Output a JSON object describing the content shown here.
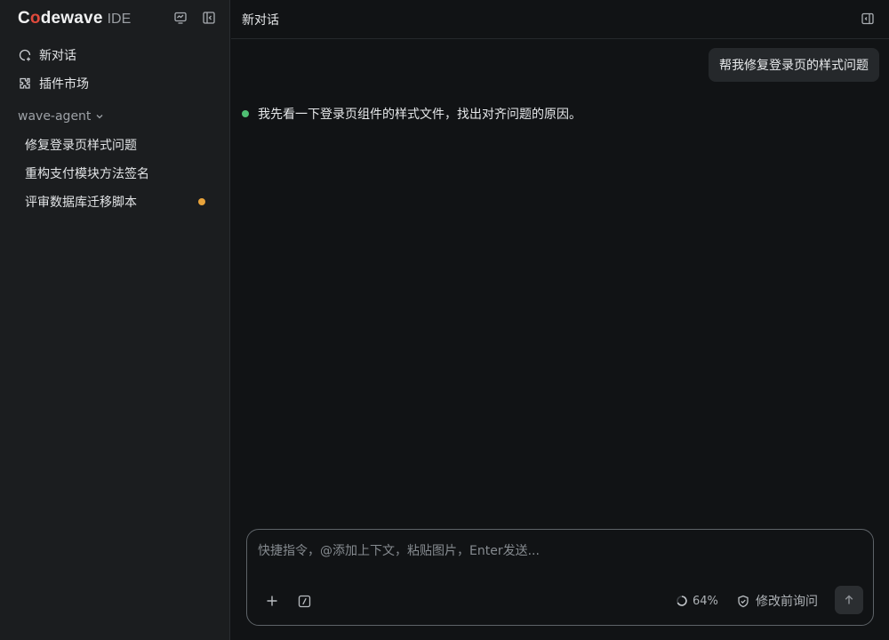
{
  "app": {
    "brand_c": "C",
    "brand_o": "o",
    "brand_rest": "dewave",
    "brand_suffix": "IDE"
  },
  "icons": {
    "monitor": "monitor-icon",
    "sidebar_toggle": "sidebar-collapse-icon",
    "new_chat": "new-chat-icon",
    "plugins": "puzzle-icon",
    "chevron": "chevron-down-icon",
    "panel": "panel-toggle-icon",
    "add": "plus-icon",
    "slash": "slash-command-icon",
    "progress": "spinner-icon",
    "shield": "shield-check-icon",
    "send": "arrow-up-icon"
  },
  "sidebar": {
    "nav": [
      {
        "label": "新对话"
      },
      {
        "label": "插件市场"
      }
    ],
    "group": {
      "label": "wave-agent"
    },
    "sessions": [
      {
        "label": "修复登录页样式问题",
        "unread": false
      },
      {
        "label": "重构支付模块方法签名",
        "unread": false
      },
      {
        "label": "评审数据库迁移脚本",
        "unread": true
      }
    ]
  },
  "main": {
    "title": "新对话",
    "user_message": "帮我修复登录页的样式问题",
    "assistant_message": "我先看一下登录页组件的样式文件，找出对齐问题的原因。"
  },
  "composer": {
    "placeholder": "快捷指令，@添加上下文，粘贴图片，Enter发送...",
    "value": "",
    "context_usage": "64%",
    "context_fraction": 0.64,
    "mode_label": "修改前询问"
  },
  "colors": {
    "brand_accent": "#e04a3c",
    "unread_dot": "#e8a33b",
    "status_dot": "#4fbf73",
    "background": "#111315",
    "sidebar_bg": "#1b1d1f"
  }
}
